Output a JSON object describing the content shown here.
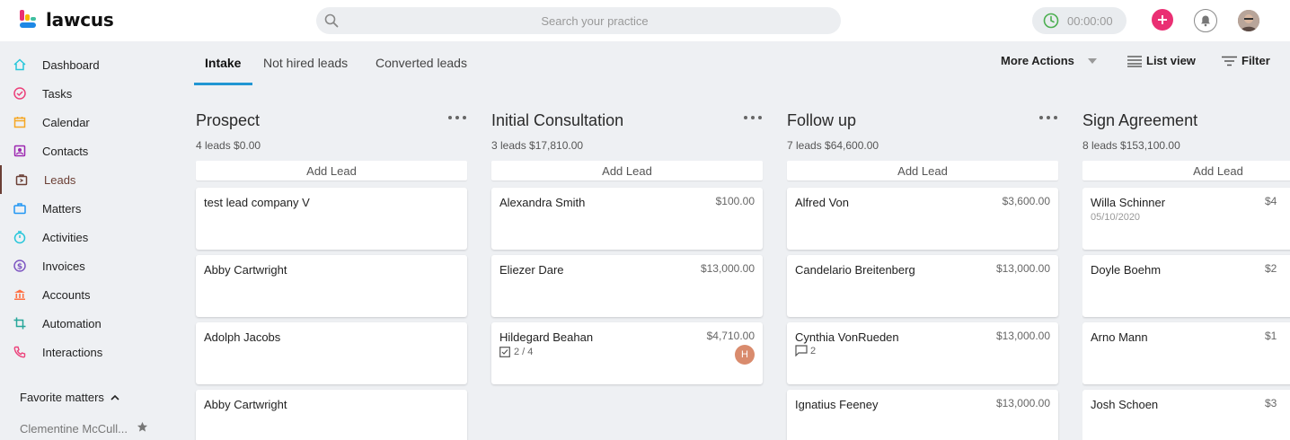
{
  "app": {
    "name": "lawcus"
  },
  "header": {
    "search_placeholder": "Search your practice",
    "timer": "00:00:00",
    "colors": {
      "add": "#ea2f73",
      "timer_icon": "#4caf50"
    },
    "icons": [
      "search-icon",
      "clock-icon",
      "plus-icon",
      "bell-icon",
      "user-avatar"
    ]
  },
  "sidebar": {
    "items": [
      {
        "label": "Dashboard",
        "icon": "home-icon",
        "color": "#26c6da"
      },
      {
        "label": "Tasks",
        "icon": "check-circle-icon",
        "color": "#ec407a"
      },
      {
        "label": "Calendar",
        "icon": "calendar-icon",
        "color": "#f5a623"
      },
      {
        "label": "Contacts",
        "icon": "contact-card-icon",
        "color": "#9c27b0"
      },
      {
        "label": "Leads",
        "icon": "leads-icon",
        "color": "#6b3f35",
        "active": true
      },
      {
        "label": "Matters",
        "icon": "briefcase-icon",
        "color": "#2196f3"
      },
      {
        "label": "Activities",
        "icon": "stopwatch-icon",
        "color": "#26c6da"
      },
      {
        "label": "Invoices",
        "icon": "dollar-circle-icon",
        "color": "#7e57c2"
      },
      {
        "label": "Accounts",
        "icon": "bank-icon",
        "color": "#ff7043"
      },
      {
        "label": "Automation",
        "icon": "crop-icon",
        "color": "#26a69a"
      },
      {
        "label": "Interactions",
        "icon": "phone-icon",
        "color": "#ec407a"
      }
    ],
    "favorites": {
      "title": "Favorite matters",
      "items": [
        {
          "label": "Clementine McCull..."
        }
      ]
    }
  },
  "tabs": [
    {
      "label": "Intake",
      "active": true
    },
    {
      "label": "Not hired leads"
    },
    {
      "label": "Converted leads"
    }
  ],
  "actions": {
    "more": "More Actions",
    "list_view": "List view",
    "filter": "Filter"
  },
  "add_lead_label": "Add Lead",
  "columns": [
    {
      "title": "Prospect",
      "meta": "4 leads $0.00",
      "cards": [
        {
          "name": "test lead company V",
          "amount": ""
        },
        {
          "name": "Abby Cartwright",
          "amount": ""
        },
        {
          "name": "Adolph Jacobs",
          "amount": ""
        },
        {
          "name": "Abby Cartwright",
          "amount": ""
        }
      ]
    },
    {
      "title": "Initial Consultation",
      "meta": "3 leads $17,810.00",
      "cards": [
        {
          "name": "Alexandra Smith",
          "amount": "$100.00"
        },
        {
          "name": "Eliezer Dare",
          "amount": "$13,000.00"
        },
        {
          "name": "Hildegard Beahan",
          "amount": "$4,710.00",
          "tasks": "2 / 4",
          "avatar": "H"
        }
      ]
    },
    {
      "title": "Follow up",
      "meta": "7 leads $64,600.00",
      "cards": [
        {
          "name": "Alfred Von",
          "amount": "$3,600.00"
        },
        {
          "name": "Candelario Breitenberg",
          "amount": "$13,000.00"
        },
        {
          "name": "Cynthia VonRueden",
          "amount": "$13,000.00",
          "comments": "2"
        },
        {
          "name": "Ignatius Feeney",
          "amount": "$13,000.00"
        }
      ]
    },
    {
      "title": "Sign Agreement",
      "meta": "8 leads $153,100.00",
      "cards": [
        {
          "name": "Willa Schinner",
          "amount": "$4",
          "date": "05/10/2020"
        },
        {
          "name": "Doyle Boehm",
          "amount": "$2"
        },
        {
          "name": "Arno Mann",
          "amount": "$1"
        },
        {
          "name": "Josh Schoen",
          "amount": "$3"
        }
      ]
    }
  ]
}
